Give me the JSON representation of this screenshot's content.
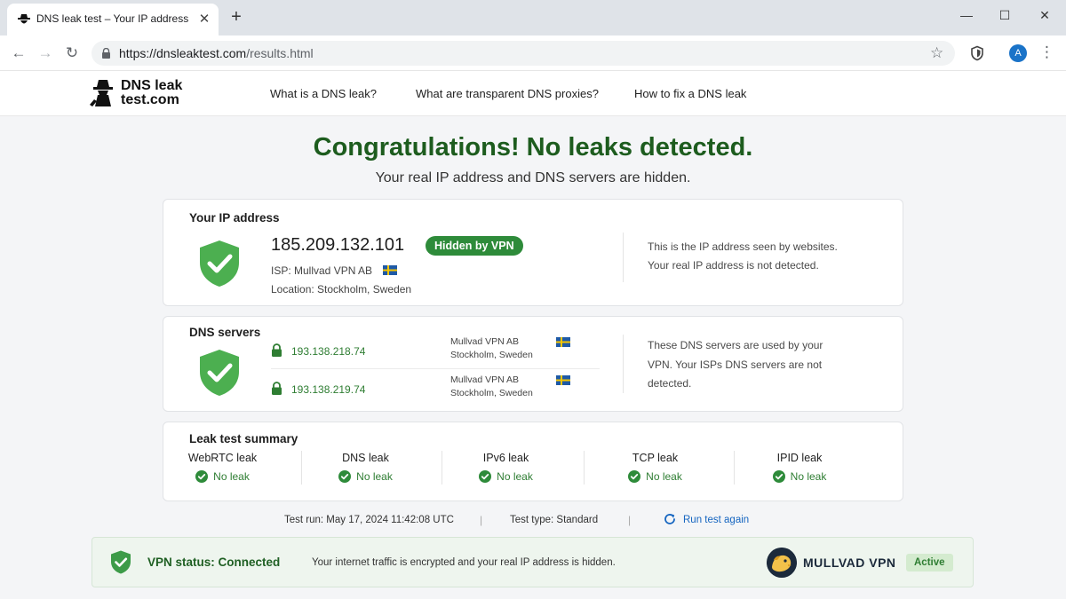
{
  "browser": {
    "tab_title": "DNS leak test – Your IP address",
    "url_host": "https://dnsleaktest.com",
    "url_path": "/results.html",
    "avatar_letter": "A",
    "icons": [
      "back-icon",
      "forward-icon",
      "reload-icon",
      "lock-icon",
      "star-icon",
      "shield-icon",
      "kebab-menu-icon",
      "close-icon",
      "plus-icon",
      "minimize-icon",
      "maximize-icon"
    ]
  },
  "site": {
    "logo_line1": "DNS leak",
    "logo_line2": "test.com",
    "nav": [
      "What is a DNS leak?",
      "What are transparent DNS proxies?",
      "How to fix a DNS leak"
    ]
  },
  "result": {
    "headline": "Congratulations! No leaks detected.",
    "subline": "Your real IP address and DNS servers are hidden."
  },
  "ip_card": {
    "title": "Your IP address",
    "ip": "185.209.132.101",
    "badge": "Hidden by VPN",
    "isp": "ISP: Mullvad VPN AB",
    "location": "Location: Stockholm, Sweden",
    "note_line1": "This is the IP address seen by websites.",
    "note_line2": "Your real IP address is not detected."
  },
  "dns_card": {
    "title": "DNS servers",
    "servers": [
      {
        "ip": "193.138.218.74",
        "org": "Mullvad VPN AB",
        "city": "Stockholm, Sweden"
      },
      {
        "ip": "193.138.219.74",
        "org": "Mullvad VPN AB",
        "city": "Stockholm, Sweden"
      }
    ],
    "note_line1": "These DNS servers are used by your",
    "note_line2": "VPN. Your ISPs DNS servers are not",
    "note_line3": "detected."
  },
  "summary": {
    "title": "Leak test summary",
    "items": [
      {
        "label": "WebRTC leak",
        "value": "No leak"
      },
      {
        "label": "DNS leak",
        "value": "No leak"
      },
      {
        "label": "IPv6 leak",
        "value": "No leak"
      },
      {
        "label": "TCP leak",
        "value": "No leak"
      },
      {
        "label": "IPID leak",
        "value": "No leak"
      }
    ]
  },
  "footer": {
    "test_run": "Test run: May 17, 2024 11:42:08 UTC",
    "test_type": "Test type: Standard",
    "rerun": "Run test again"
  },
  "vpn": {
    "status": "VPN status: Connected",
    "message": "Your internet traffic is encrypted and your real IP address is hidden.",
    "brand": "MULLVAD VPN",
    "badge": "Active"
  },
  "colors": {
    "success_green": "#2e8b3a",
    "headline_green": "#1d5c1e",
    "link_blue": "#1565c0",
    "shield_green": "#4caf50"
  }
}
